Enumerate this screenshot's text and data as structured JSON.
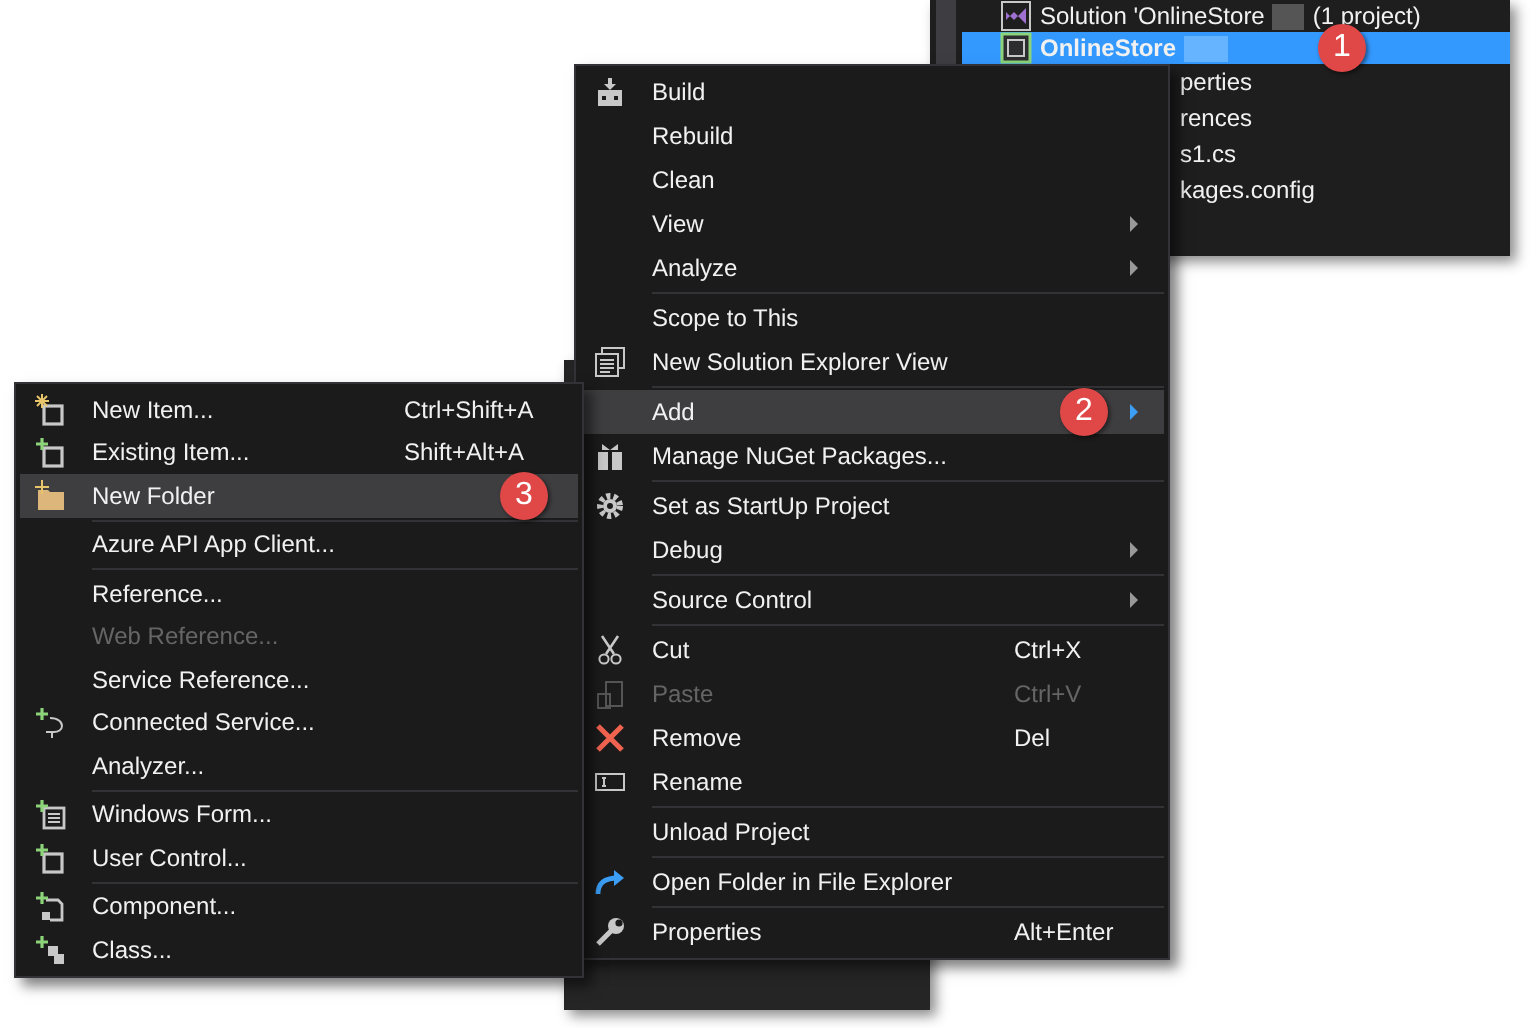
{
  "solution_explorer": {
    "rows": [
      {
        "kind": "solution",
        "label": "Solution 'OnlineStore",
        "redacted": true,
        "suffix": "(1 project)",
        "selected": false
      },
      {
        "kind": "project",
        "label": "OnlineStore",
        "redacted": true,
        "selected": true,
        "badge": "1"
      },
      {
        "kind": "child",
        "label": "perties",
        "selected": false
      },
      {
        "kind": "child",
        "label": "rences",
        "selected": false
      },
      {
        "kind": "child",
        "label": "s1.cs",
        "selected": false
      },
      {
        "kind": "child",
        "label": "kages.config",
        "selected": false
      }
    ]
  },
  "context_menu": {
    "items": [
      {
        "kind": "item",
        "label": "Build",
        "selected": false,
        "disabled": false,
        "submenu": false
      },
      {
        "kind": "item",
        "label": "Rebuild",
        "selected": false,
        "disabled": false,
        "submenu": false
      },
      {
        "kind": "item",
        "label": "Clean",
        "selected": false,
        "disabled": false,
        "submenu": false
      },
      {
        "kind": "item",
        "label": "View",
        "selected": false,
        "disabled": false,
        "submenu": true
      },
      {
        "kind": "item",
        "label": "Analyze",
        "selected": false,
        "disabled": false,
        "submenu": true
      },
      {
        "kind": "separator"
      },
      {
        "kind": "item",
        "label": "Scope to This",
        "selected": false,
        "disabled": false,
        "submenu": false
      },
      {
        "kind": "item",
        "label": "New Solution Explorer View",
        "selected": false,
        "disabled": false,
        "submenu": false
      },
      {
        "kind": "separator"
      },
      {
        "kind": "item",
        "label": "Add",
        "selected": true,
        "disabled": false,
        "submenu": true,
        "badge": "2"
      },
      {
        "kind": "item",
        "label": "Manage NuGet Packages...",
        "selected": false,
        "disabled": false,
        "submenu": false
      },
      {
        "kind": "separator"
      },
      {
        "kind": "item",
        "label": "Set as StartUp Project",
        "selected": false,
        "disabled": false,
        "submenu": false
      },
      {
        "kind": "item",
        "label": "Debug",
        "selected": false,
        "disabled": false,
        "submenu": true
      },
      {
        "kind": "separator"
      },
      {
        "kind": "item",
        "label": "Source Control",
        "selected": false,
        "disabled": false,
        "submenu": true
      },
      {
        "kind": "separator"
      },
      {
        "kind": "item",
        "label": "Cut",
        "shortcut": "Ctrl+X",
        "selected": false,
        "disabled": false,
        "submenu": false
      },
      {
        "kind": "item",
        "label": "Paste",
        "shortcut": "Ctrl+V",
        "selected": false,
        "disabled": true,
        "submenu": false
      },
      {
        "kind": "item",
        "label": "Remove",
        "shortcut": "Del",
        "selected": false,
        "disabled": false,
        "submenu": false
      },
      {
        "kind": "item",
        "label": "Rename",
        "selected": false,
        "disabled": false,
        "submenu": false
      },
      {
        "kind": "separator"
      },
      {
        "kind": "item",
        "label": "Unload Project",
        "selected": false,
        "disabled": false,
        "submenu": false
      },
      {
        "kind": "separator"
      },
      {
        "kind": "item",
        "label": "Open Folder in File Explorer",
        "selected": false,
        "disabled": false,
        "submenu": false
      },
      {
        "kind": "separator"
      },
      {
        "kind": "item",
        "label": "Properties",
        "shortcut": "Alt+Enter",
        "selected": false,
        "disabled": false,
        "submenu": false
      }
    ]
  },
  "add_submenu": {
    "items": [
      {
        "kind": "item",
        "label": "New Item...",
        "shortcut": "Ctrl+Shift+A",
        "selected": false,
        "disabled": false
      },
      {
        "kind": "item",
        "label": "Existing Item...",
        "shortcut": "Shift+Alt+A",
        "selected": false,
        "disabled": false
      },
      {
        "kind": "item",
        "label": "New Folder",
        "selected": true,
        "disabled": false,
        "badge": "3"
      },
      {
        "kind": "separator"
      },
      {
        "kind": "item",
        "label": "Azure API App Client...",
        "selected": false,
        "disabled": false
      },
      {
        "kind": "separator"
      },
      {
        "kind": "item",
        "label": "Reference...",
        "selected": false,
        "disabled": false
      },
      {
        "kind": "item",
        "label": "Web Reference...",
        "selected": false,
        "disabled": true
      },
      {
        "kind": "item",
        "label": "Service Reference...",
        "selected": false,
        "disabled": false
      },
      {
        "kind": "item",
        "label": "Connected Service...",
        "selected": false,
        "disabled": false
      },
      {
        "kind": "item",
        "label": "Analyzer...",
        "selected": false,
        "disabled": false
      },
      {
        "kind": "separator"
      },
      {
        "kind": "item",
        "label": "Windows Form...",
        "selected": false,
        "disabled": false
      },
      {
        "kind": "item",
        "label": "User Control...",
        "selected": false,
        "disabled": false
      },
      {
        "kind": "separator"
      },
      {
        "kind": "item",
        "label": "Component...",
        "selected": false,
        "disabled": false
      },
      {
        "kind": "item",
        "label": "Class...",
        "selected": false,
        "disabled": false
      }
    ]
  }
}
